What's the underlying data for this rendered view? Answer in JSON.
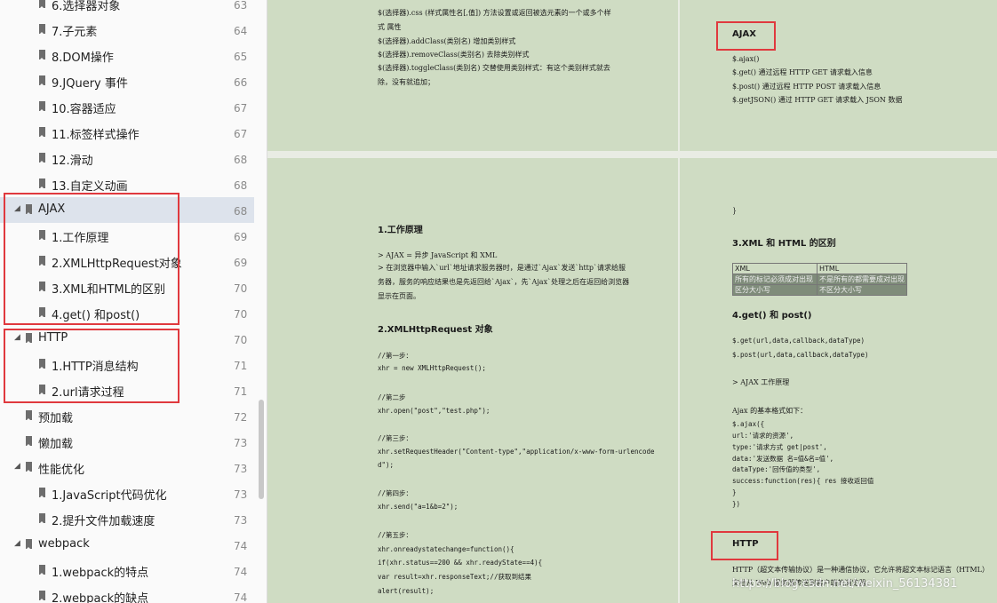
{
  "sidebar": {
    "items": [
      {
        "label": "6.选择器对象",
        "page": "63"
      },
      {
        "label": "7.子元素",
        "page": "64"
      },
      {
        "label": "8.DOM操作",
        "page": "65"
      },
      {
        "label": "9.JQuery 事件",
        "page": "66"
      },
      {
        "label": "10.容器适应",
        "page": "67"
      },
      {
        "label": "11.标签样式操作",
        "page": "67"
      },
      {
        "label": "12.滑动",
        "page": "68"
      },
      {
        "label": "13.自定义动画",
        "page": "68"
      },
      {
        "label": "AJAX",
        "page": "68"
      },
      {
        "label": "1.工作原理",
        "page": "69"
      },
      {
        "label": "2.XMLHttpRequest对象",
        "page": "69"
      },
      {
        "label": "3.XML和HTML的区别",
        "page": "70"
      },
      {
        "label": "4.get() 和post()",
        "page": "70"
      },
      {
        "label": "HTTP",
        "page": "70"
      },
      {
        "label": "1.HTTP消息结构",
        "page": "71"
      },
      {
        "label": "2.url请求过程",
        "page": "71"
      },
      {
        "label": "预加载",
        "page": "72"
      },
      {
        "label": "懒加载",
        "page": "73"
      },
      {
        "label": "性能优化",
        "page": "73"
      },
      {
        "label": "1.JavaScript代码优化",
        "page": "73"
      },
      {
        "label": "2.提升文件加载速度",
        "page": "73"
      },
      {
        "label": "webpack",
        "page": "74"
      },
      {
        "label": "1.webpack的特点",
        "page": "74"
      },
      {
        "label": "2.webpack的缺点",
        "page": "74"
      }
    ]
  },
  "pages": {
    "p1": [
      "$(选择器).css (样式属性名[,值]) 方法设置或返回被选元素的一个或多个样",
      "式 属性",
      "$(选择器).addClass(类别名)  增加类别样式",
      "$(选择器).removeClass(类别名)  去除类别样式",
      "$(选择器).toggleClass(类别名)  交替使用类别样式：有这个类别样式就去",
      "除，没有就追加；"
    ],
    "p2_title": "AJAX",
    "p2": [
      "$.ajax()",
      "$.get() 通过远程 HTTP GET 请求载入信息",
      "$.post() 通过远程 HTTP POST 请求载入信息",
      "$.getJSON() 通过 HTTP GET 请求载入 JSON 数据"
    ],
    "p3": {
      "h1": "1.工作原理",
      "t1": [
        "> AJAX = 异步 JavaScript 和 XML",
        "> 在浏览器中输入`url`地址请求服务器时，是通过`Ajax`发送`http`请求给服",
        "务器，服务的响应结果也是先返回给`Ajax`，先`Ajax`处理之后在返回给浏览器",
        "显示在页面。"
      ],
      "h2": "2.XMLHttpRequest 对象",
      "code": [
        "//第一步：",
        "xhr = new XMLHttpRequest();",
        "//第二步",
        "xhr.open(\"post\",\"test.php\");",
        "//第三步：",
        "xhr.setRequestHeader(\"Content-type\",\"application/x-www-form-urlencode",
        "d\");",
        "//第四步：",
        "xhr.send(\"a=1&b=2\");",
        "//第五步：",
        "xhr.onreadystatechange=function(){",
        "    if(xhr.status==200 && xhr.readyState==4){",
        "        var result=xhr.responseText;//获取到结果",
        "    alert(result);"
      ]
    },
    "p4": {
      "brace": "}",
      "h1": "3.XML 和 HTML 的区别",
      "table": [
        [
          "XML",
          "HTML"
        ],
        [
          "所有的标记必须成对出现",
          "不是所有的都需要成对出现"
        ],
        [
          "区分大小写",
          "不区分大小写"
        ]
      ],
      "h2": "4.get() 和 post()",
      "t1": [
        "$.get(url,data,callback,dataType)",
        "$.post(url,data,callback,dataType)",
        "> AJAX 工作原理",
        "Ajax 的基本格式如下：",
        "$.ajax({",
        "    url:'请求的资源',",
        "    type:'请求方式 get|post',",
        "    data:'发送数据 名=值&名=值',",
        "    dataType:'回传值的类型',",
        "    success:function(res){ res 接收返回值",
        "    }",
        "})"
      ],
      "h3": "HTTP",
      "t2": [
        "HTTP（超文本传输协议）是一种通信协议，它允许将超文本标记语言（HTML）",
        "文档从 Web 服务器传送到客户端的浏览器。"
      ]
    }
  },
  "watermark": "https://blog.csdn.net/weixin_56134381",
  "colors": {
    "page_bg": "#cfdcc3",
    "highlight_box": "#e0393e",
    "selected_row": "#dde3ec"
  }
}
